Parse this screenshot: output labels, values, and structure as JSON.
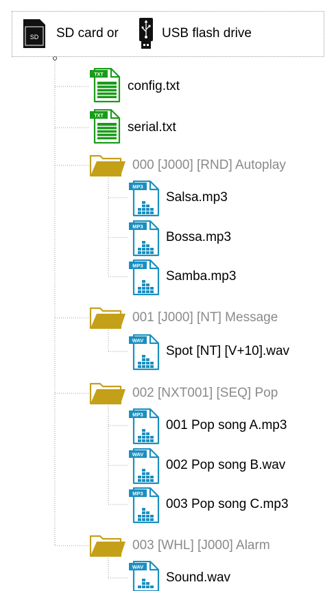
{
  "root": {
    "sd_label": "SD card or",
    "usb_label": "USB flash drive",
    "sd_icon": "sd-card-icon",
    "sd_icon_text": "SD",
    "usb_icon": "usb-drive-icon"
  },
  "colors": {
    "text_file": "#1a9b1a",
    "folder": "#c4a019",
    "audio_file": "#1a8fc0",
    "folder_label": "#8a8a8a",
    "connector": "#9a9a9a"
  },
  "badges": {
    "txt": "TXT",
    "mp3": "MP3",
    "wav": "WAV"
  },
  "tree": {
    "config": "config.txt",
    "serial": "serial.txt",
    "folder0": "000 [J000] [RND] Autoplay",
    "f0_1": "Salsa.mp3",
    "f0_2": "Bossa.mp3",
    "f0_3": "Samba.mp3",
    "folder1": "001 [J000] [NT] Message",
    "f1_1": "Spot [NT] [V+10].wav",
    "folder2": "002 [NXT001] [SEQ] Pop",
    "f2_1": "001 Pop song A.mp3",
    "f2_2": "002 Pop song B.wav",
    "f2_3": "003 Pop song C.mp3",
    "folder3": "003 [WHL] [J000] Alarm",
    "f3_1": "Sound.wav"
  }
}
